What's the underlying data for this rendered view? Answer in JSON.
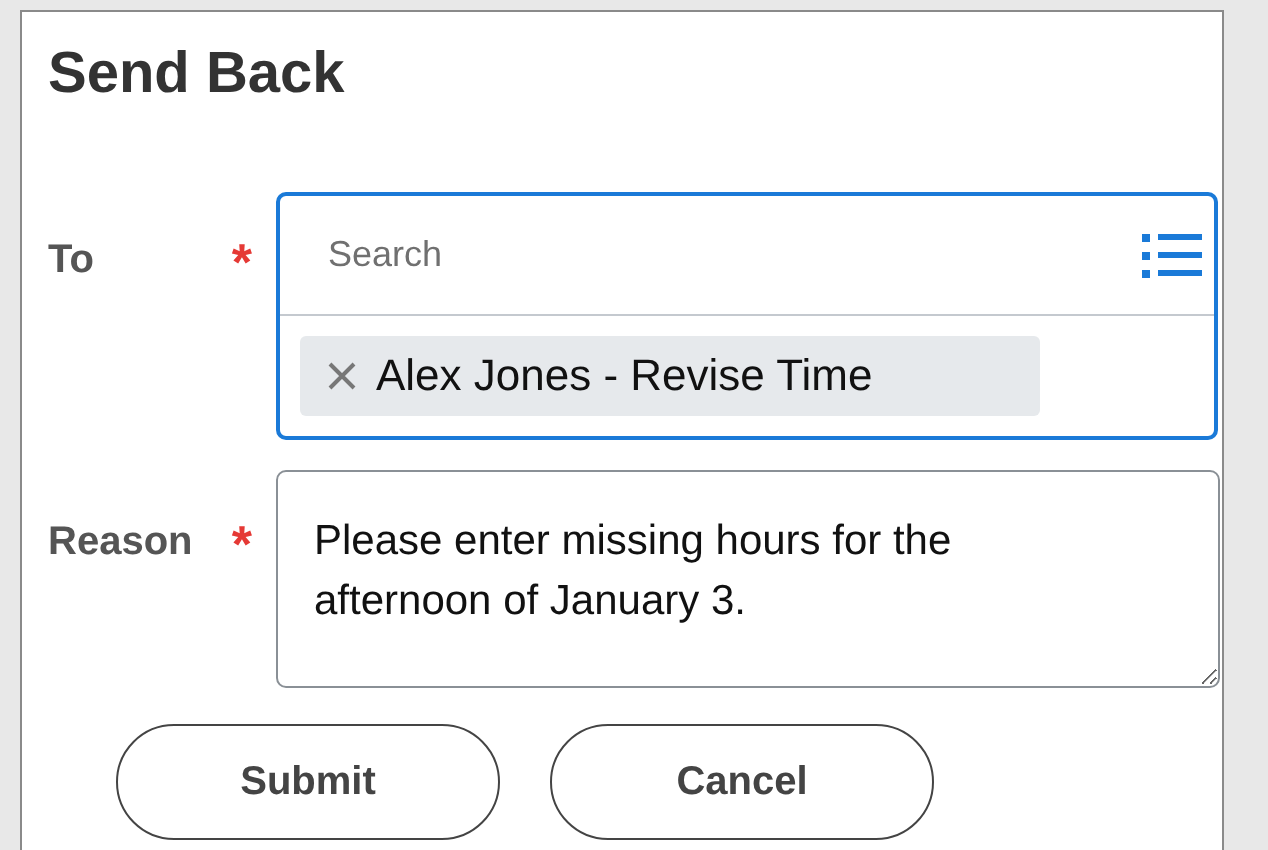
{
  "dialog": {
    "title": "Send Back"
  },
  "to": {
    "label": "To",
    "required_mark": "*",
    "search": {
      "placeholder": "Search"
    },
    "selected": [
      {
        "label": "Alex Jones - Revise Time"
      }
    ]
  },
  "reason": {
    "label": "Reason",
    "required_mark": "*",
    "value": "Please enter missing hours for the afternoon of January 3."
  },
  "buttons": [
    {
      "label": "Submit"
    },
    {
      "label": "Cancel"
    }
  ]
}
